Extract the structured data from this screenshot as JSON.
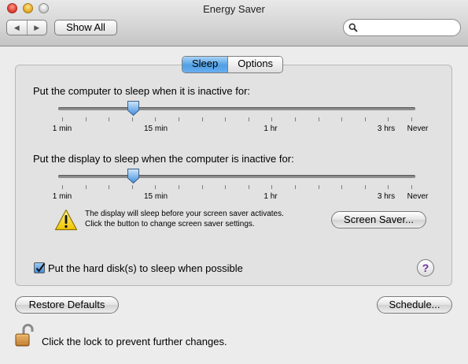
{
  "window": {
    "title": "Energy Saver"
  },
  "toolbar": {
    "back_glyph": "◀",
    "forward_glyph": "▶",
    "show_all_label": "Show All",
    "search": {
      "value": "",
      "placeholder": ""
    }
  },
  "tabs": [
    {
      "label": "Sleep",
      "selected": true
    },
    {
      "label": "Options",
      "selected": false
    }
  ],
  "computer_sleep": {
    "label": "Put the computer to sleep when it is inactive for:",
    "value": "15 min",
    "tick_labels": [
      "1 min",
      "15 min",
      "1 hr",
      "3 hrs",
      "Never"
    ]
  },
  "display_sleep": {
    "label": "Put the display to sleep when the computer is inactive for:",
    "value": "15 min",
    "tick_labels": [
      "1 min",
      "15 min",
      "1 hr",
      "3 hrs",
      "Never"
    ]
  },
  "warning": {
    "line1": "The display will sleep before your screen saver activates.",
    "line2": "Click the button to change screen saver settings.",
    "icon": "warning-icon"
  },
  "screen_saver_label": "Screen Saver...",
  "hard_disk": {
    "label": "Put the hard disk(s) to sleep when possible",
    "checked": true
  },
  "help_label": "?",
  "restore_defaults_label": "Restore Defaults",
  "schedule_label": "Schedule...",
  "lock_text": "Click the lock to prevent further changes.",
  "colors": {
    "accent": "#4f9fe3",
    "background": "#ececec",
    "panel": "#e2e2e2"
  }
}
